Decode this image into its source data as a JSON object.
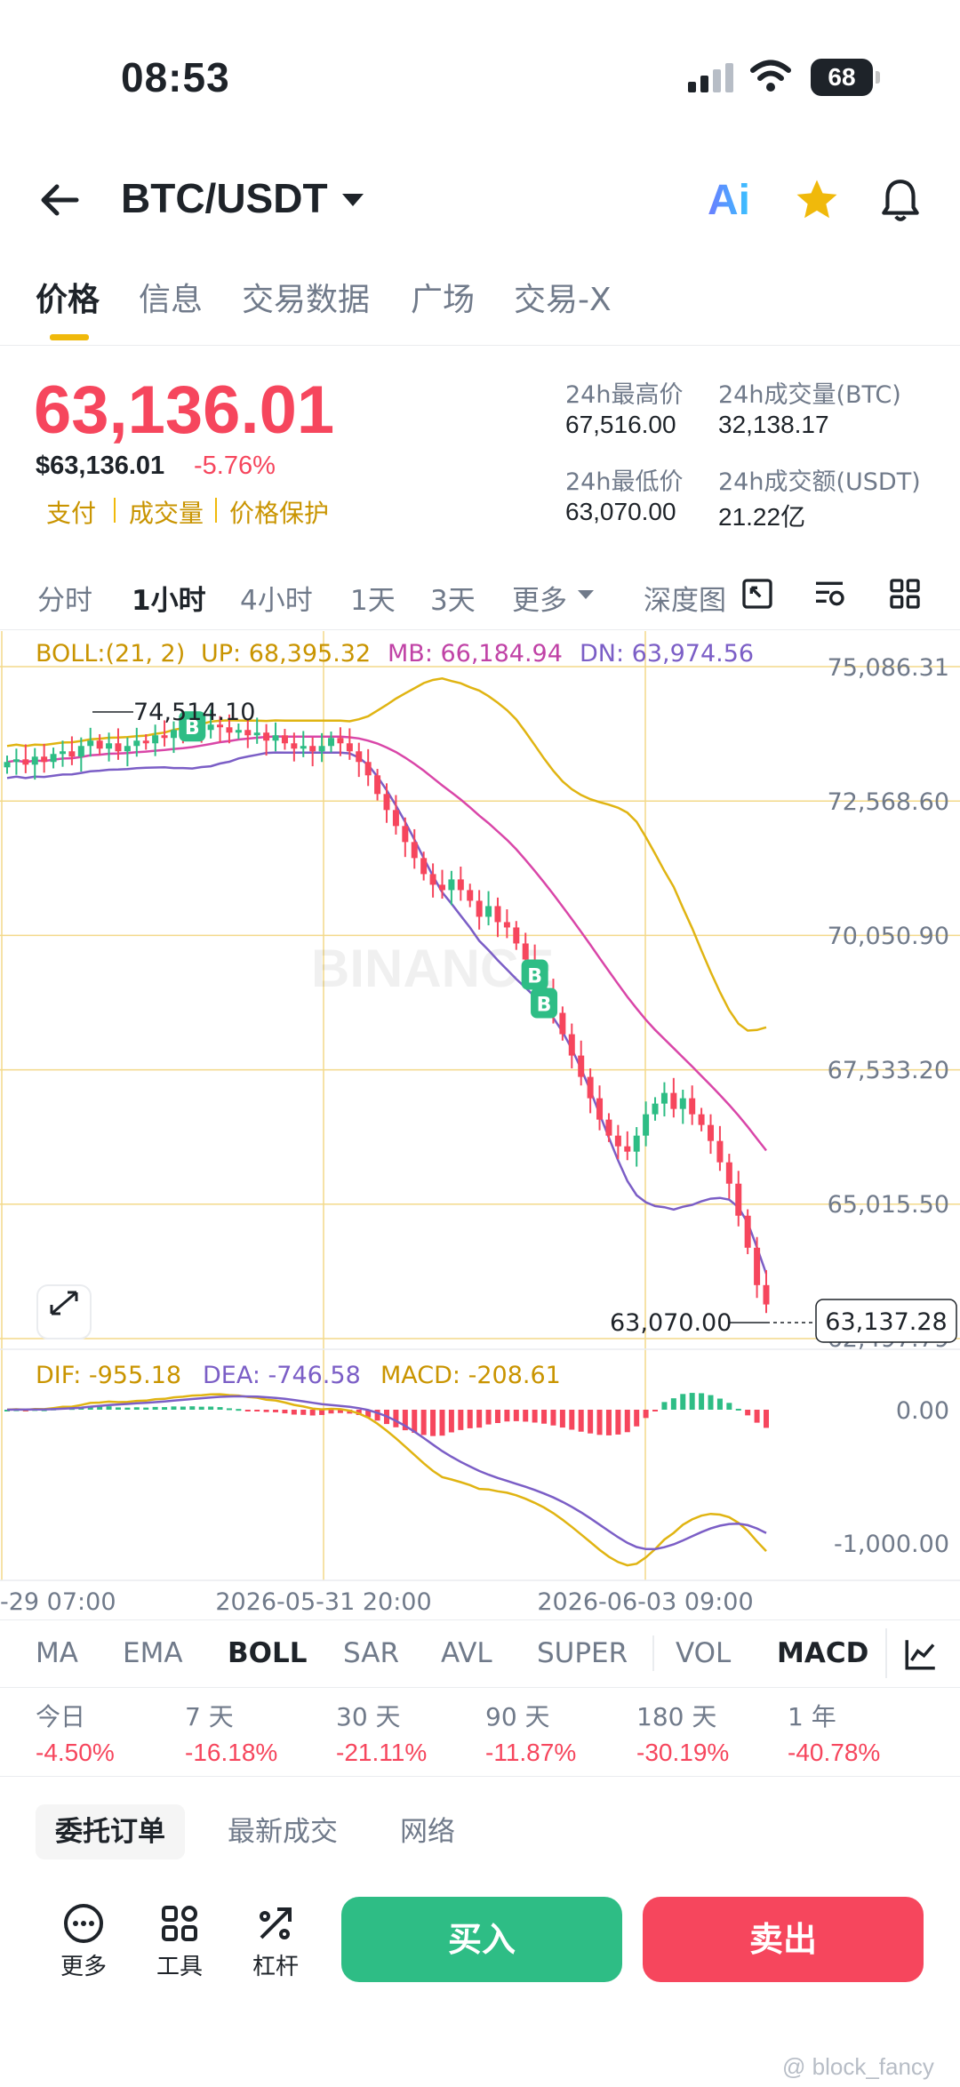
{
  "status": {
    "time": "08:53",
    "battery": "68"
  },
  "header": {
    "pair": "BTC/USDT",
    "ai_label": "Ai"
  },
  "tabs": [
    "价格",
    "信息",
    "交易数据",
    "广场",
    "交易-X"
  ],
  "price": {
    "last": "63,136.01",
    "fiat": "$63,136.01",
    "change": "-5.76%",
    "tags": [
      "支付",
      "成交量",
      "价格保护"
    ],
    "stats": {
      "high_label": "24h最高价",
      "high": "67,516.00",
      "vol_btc_label": "24h成交量(BTC)",
      "vol_btc": "32,138.17",
      "low_label": "24h最低价",
      "low": "63,070.00",
      "vol_usdt_label": "24h成交额(USDT)",
      "vol_usdt": "21.22亿"
    }
  },
  "timeframes": [
    "分时",
    "1小时",
    "4小时",
    "1天",
    "3天",
    "更多",
    "深度图"
  ],
  "active_timeframe": "1小时",
  "chart_data": {
    "type": "candlestick",
    "boll": {
      "label": "BOLL:(21, 2)",
      "up": "UP: 68,395.32",
      "mb": "MB: 66,184.94",
      "dn": "DN: 63,974.56"
    },
    "y_ticks": [
      "75,086.31",
      "72,568.60",
      "70,050.90",
      "67,533.20",
      "65,015.50",
      "62,497.79"
    ],
    "ylim": [
      62497.79,
      75086.31
    ],
    "x_labels": [
      "-29 07:00",
      "2026-05-31 20:00",
      "2026-06-03 09:00"
    ],
    "high_marker": "74,514.10",
    "low_marker": "63,070.00",
    "current_price": "63,137.28",
    "closes": [
      73300,
      73350,
      73250,
      73400,
      73300,
      73450,
      73500,
      73400,
      73600,
      73700,
      73550,
      73650,
      73500,
      73600,
      73700,
      73650,
      73800,
      73750,
      73900,
      73850,
      73950,
      73900,
      74000,
      73950,
      73850,
      73900,
      73800,
      73850,
      73700,
      73800,
      73650,
      73550,
      73600,
      73500,
      73600,
      73750,
      73650,
      73500,
      73300,
      73050,
      72700,
      72400,
      72100,
      71800,
      71500,
      71200,
      71000,
      70900,
      71100,
      70900,
      70700,
      70400,
      70600,
      70300,
      70200,
      69900,
      69600,
      69300,
      69000,
      68600,
      68200,
      67800,
      67400,
      67000,
      66600,
      66300,
      66100,
      66000,
      66300,
      66700,
      66900,
      67100,
      66800,
      67000,
      66700,
      66500,
      66200,
      65800,
      65400,
      64800,
      64200,
      63500,
      63137
    ],
    "macd": {
      "dif": "DIF: -955.18",
      "dea": "DEA: -746.58",
      "macd": "MACD: -208.61",
      "y_ticks": [
        "0.00",
        "-1,000.00"
      ]
    },
    "colors": {
      "up": "#2ebd85",
      "down": "#f6465d",
      "boll_up": "#e0b412",
      "boll_mb": "#d946a8",
      "boll_dn": "#7b5ec6",
      "grid": "#f3d98a"
    },
    "trade_markers": [
      "B",
      "B",
      "B"
    ],
    "watermark": "BINANCE"
  },
  "indicators": [
    "MA",
    "EMA",
    "BOLL",
    "SAR",
    "AVL",
    "SUPER",
    "VOL",
    "MACD"
  ],
  "active_indicators": [
    "BOLL",
    "MACD"
  ],
  "performance": [
    {
      "label": "今日",
      "value": "-4.50%"
    },
    {
      "label": "7 天",
      "value": "-16.18%"
    },
    {
      "label": "30 天",
      "value": "-21.11%"
    },
    {
      "label": "90 天",
      "value": "-11.87%"
    },
    {
      "label": "180 天",
      "value": "-30.19%"
    },
    {
      "label": "1 年",
      "value": "-40.78%"
    }
  ],
  "order_tabs": [
    "委托订单",
    "最新成交",
    "网络"
  ],
  "bottom": {
    "more": "更多",
    "tools": "工具",
    "leverage": "杠杆",
    "buy": "买入",
    "sell": "卖出"
  },
  "footer_watermark": "@ block_fancy"
}
